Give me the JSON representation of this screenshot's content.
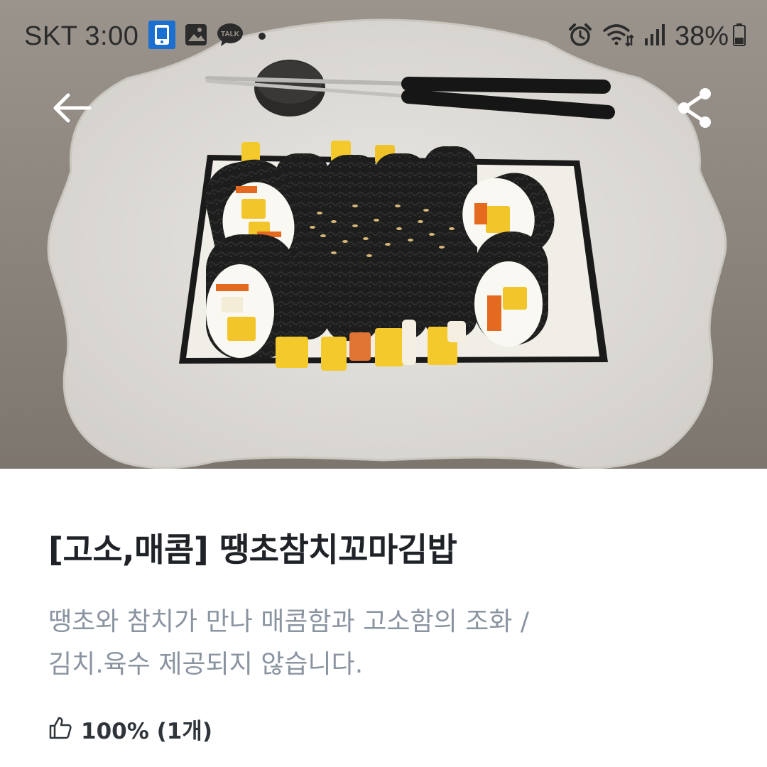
{
  "status_bar": {
    "carrier": "SKT",
    "time": "3:00",
    "notification_icons": [
      "phone-app-icon",
      "gallery-icon",
      "kakaotalk-icon",
      "dot-icon"
    ],
    "talk_badge_text": "TALK",
    "system_icons": [
      "alarm-icon",
      "wifi-icon",
      "signal-icon"
    ],
    "battery_percent": "38%",
    "battery_level": 0.38
  },
  "header": {
    "back_icon": "arrow-left-icon",
    "share_icon": "share-icon"
  },
  "product": {
    "title": "[고소,매콤] 땡초참치꼬마김밥",
    "description_line1": "땡초와 참치가 만나 매콤함과 고소함의 조화 /",
    "description_line2": "김치.육수 제공되지 않습니다.",
    "rating_icon": "thumbs-up-icon",
    "rating_text": "100% (1개)"
  },
  "colors": {
    "title": "#1f2328",
    "description": "#8a94a0",
    "rating": "#2f353b",
    "background": "#ffffff"
  }
}
